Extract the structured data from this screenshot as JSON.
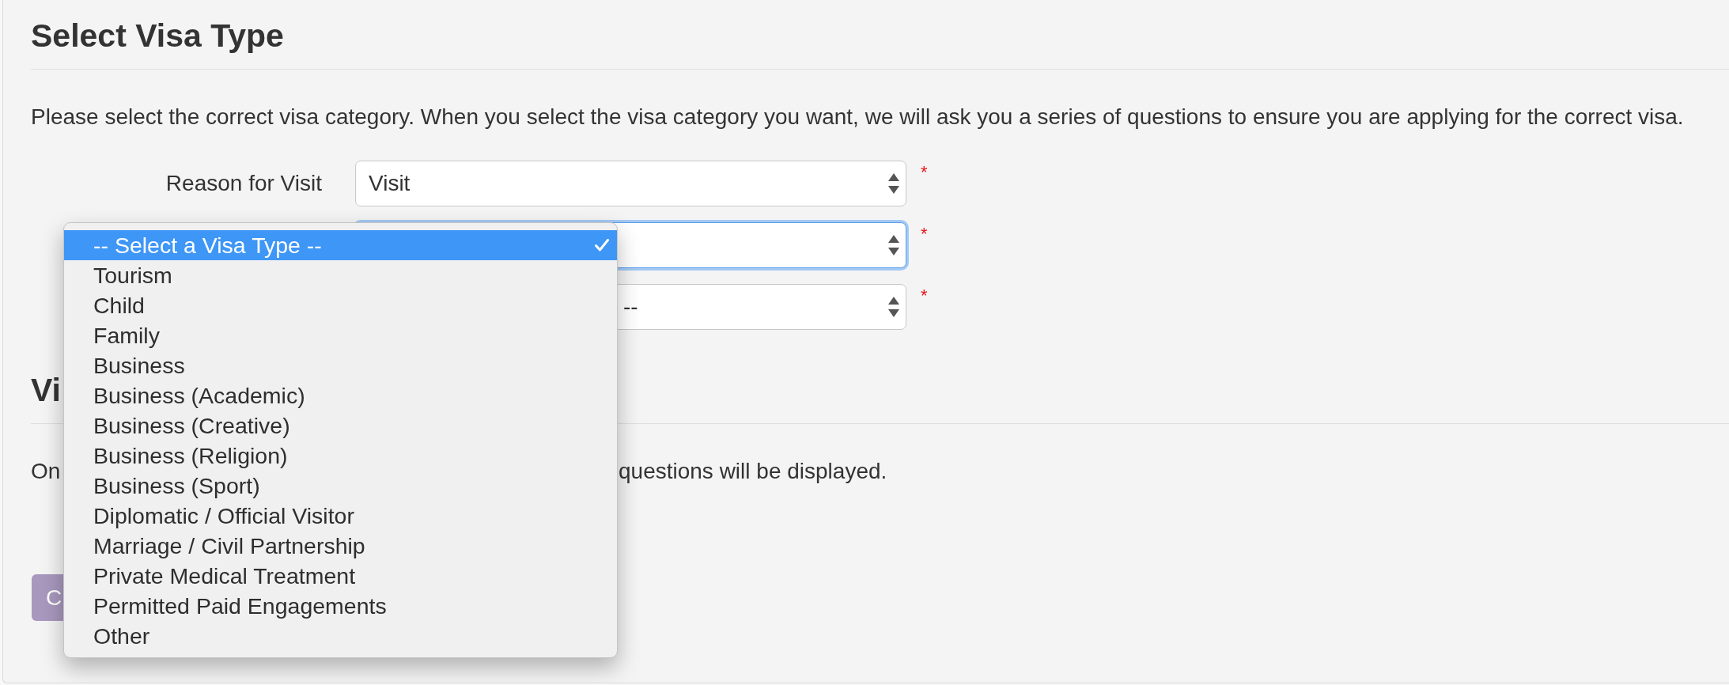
{
  "visa_type": {
    "title": "Select Visa Type",
    "intro": "Please select the correct visa category. When you select the visa category you want, we will ask you a series of questions to ensure you are applying for the correct visa.",
    "fields": [
      {
        "label": "Reason for Visit",
        "value": "Visit",
        "required_mark": "*",
        "focused": false
      },
      {
        "required_mark": "*",
        "focused": true
      },
      {
        "value": "--",
        "required_mark": "*",
        "focused": false
      }
    ]
  },
  "second_section": {
    "title": "Vi",
    "intro_fragments": [
      "On",
      "questions will be displayed."
    ]
  },
  "button": {
    "label": "C"
  },
  "visa_type_menu": {
    "options": [
      {
        "label": "-- Select a Visa Type --",
        "selected": true
      },
      {
        "label": "Tourism",
        "selected": false
      },
      {
        "label": "Child",
        "selected": false
      },
      {
        "label": "Family",
        "selected": false
      },
      {
        "label": "Business",
        "selected": false
      },
      {
        "label": "Business (Academic)",
        "selected": false
      },
      {
        "label": "Business (Creative)",
        "selected": false
      },
      {
        "label": "Business (Religion)",
        "selected": false
      },
      {
        "label": "Business (Sport)",
        "selected": false
      },
      {
        "label": "Diplomatic / Official Visitor",
        "selected": false
      },
      {
        "label": "Marriage / Civil Partnership",
        "selected": false
      },
      {
        "label": "Private Medical Treatment",
        "selected": false
      },
      {
        "label": "Permitted Paid Engagements",
        "selected": false
      },
      {
        "label": "Other",
        "selected": false
      }
    ]
  }
}
